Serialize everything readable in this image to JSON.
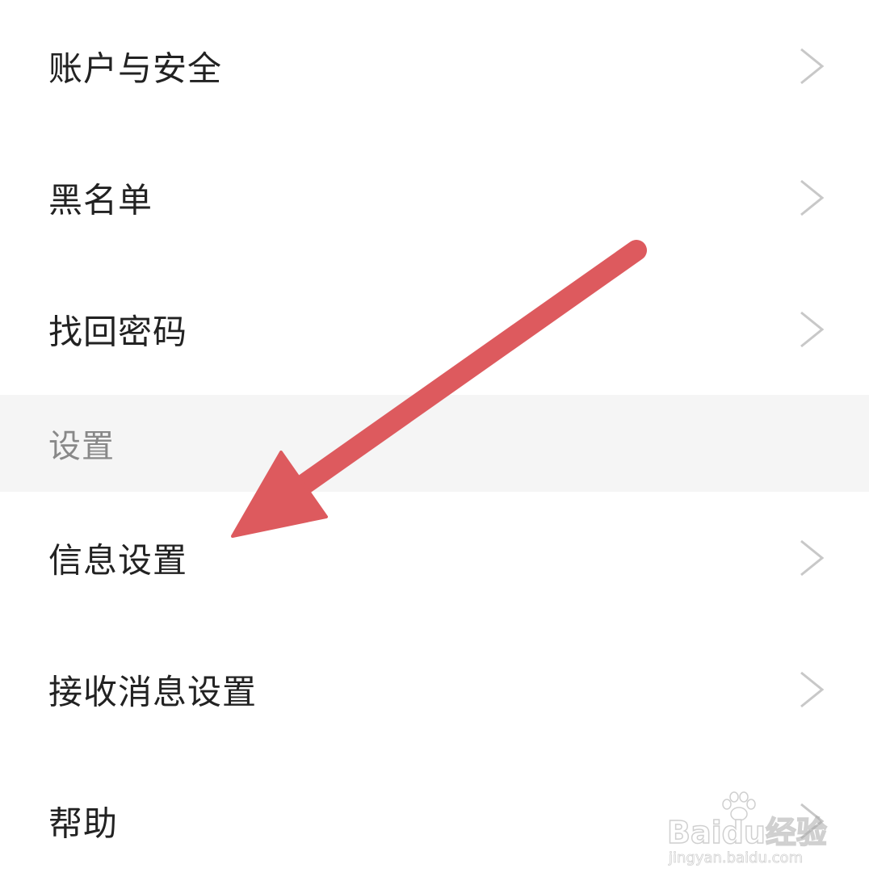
{
  "rows_top": [
    {
      "label": "账户与安全",
      "chevron": "chevron-right-icon"
    },
    {
      "label": "黑名单",
      "chevron": "chevron-right-icon"
    },
    {
      "label": "找回密码",
      "chevron": "chevron-right-icon"
    }
  ],
  "section": {
    "label": "设置"
  },
  "rows_bottom": [
    {
      "label": "信息设置",
      "chevron": "chevron-right-icon"
    },
    {
      "label": "接收消息设置",
      "chevron": "chevron-right-icon"
    },
    {
      "label": "帮助",
      "chevron": "chevron-right-icon"
    }
  ],
  "annotation": {
    "icon": "arrow-pointer-icon",
    "color": "#dd5a5e"
  },
  "watermark": {
    "brand": "Baidu经验",
    "url": "jingyan.baidu.com"
  },
  "colors": {
    "text": "#222222",
    "section_text": "#888888",
    "section_bg": "#f5f5f5",
    "chevron": "#c8c8c8"
  }
}
